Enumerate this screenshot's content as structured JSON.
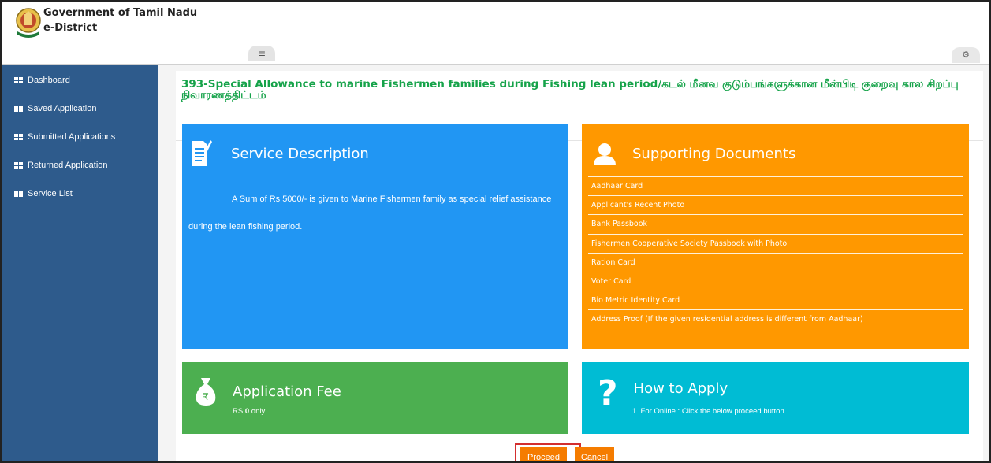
{
  "header": {
    "brand_line1": "Government of Tamil Nadu",
    "brand_line2": "e-District",
    "menu_icon": "hamburger-icon",
    "settings_icon": "cogs-icon"
  },
  "sidebar": {
    "items": [
      {
        "label": "Dashboard",
        "icon": "grid-icon"
      },
      {
        "label": "Saved Application",
        "icon": "grid-icon"
      },
      {
        "label": "Submitted Applications",
        "icon": "grid-icon"
      },
      {
        "label": "Returned Application",
        "icon": "grid-icon"
      },
      {
        "label": "Service List",
        "icon": "grid-icon"
      }
    ]
  },
  "main": {
    "title": "393-Special Allowance to marine Fishermen families during Fishing lean period/கடல் மீனவ குடும்பங்களுக்கான மீன்பிடி குறைவு கால சிறப்பு நிவாரணத்திட்டம்",
    "service_description": {
      "heading": "Service Description",
      "text": "A Sum of Rs 5000/- is given to Marine Fishermen family as special relief assistance during the lean fishing period."
    },
    "supporting_documents": {
      "heading": "Supporting Documents",
      "items": [
        "Aadhaar Card",
        "Applicant's Recent Photo",
        "Bank Passbook",
        "Fishermen Cooperative Society Passbook with Photo",
        "Ration Card",
        "Voter Card",
        "Bio Metric Identity Card",
        "Address Proof (If the given residential address is different from Aadhaar)"
      ]
    },
    "application_fee": {
      "heading": "Application Fee",
      "prefix": "RS ",
      "amount": "0",
      "suffix": " only"
    },
    "how_to_apply": {
      "heading": "How to Apply",
      "text": "1. For Online : Click the below proceed button."
    },
    "buttons": {
      "proceed": "Proceed",
      "cancel": "Cancel"
    }
  },
  "colors": {
    "sidebar": "#2e5b8c",
    "title": "#16a34a",
    "description_card": "#2196f3",
    "documents_card": "#ff9800",
    "fee_card": "#4caf50",
    "how_card": "#00bcd4",
    "button": "#f57c00",
    "highlight": "#d32f2f"
  }
}
